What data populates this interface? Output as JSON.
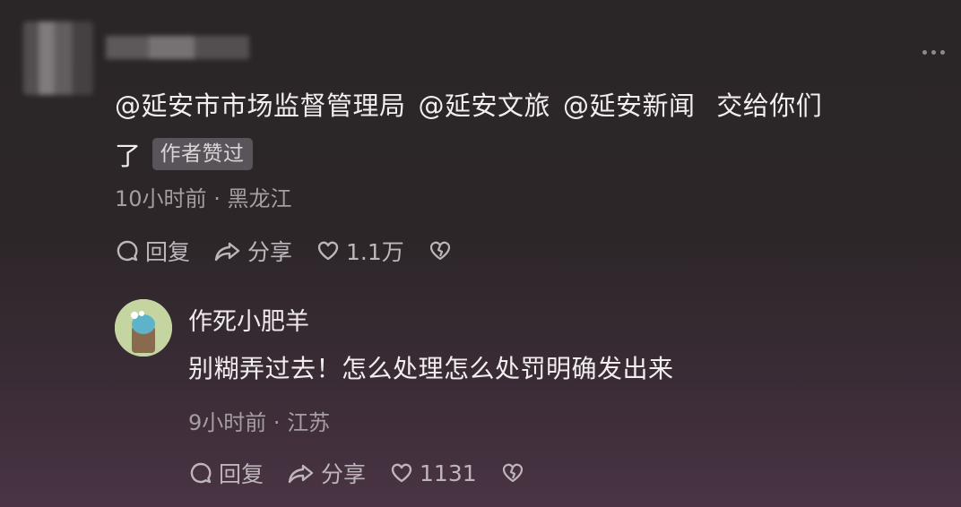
{
  "comment": {
    "mentions": [
      "@延安市市场监督管理局",
      "@延安文旅",
      "@延安新闻"
    ],
    "text_tail": "交给你们",
    "text_wrap": "了",
    "badge": "作者赞过",
    "time": "10小时前",
    "location": "黑龙江",
    "actions": {
      "reply": "回复",
      "share": "分享",
      "likes": "1.1万"
    }
  },
  "reply": {
    "username": "作死小肥羊",
    "text": "别糊弄过去！怎么处理怎么处罚明确发出来",
    "time": "9小时前",
    "location": "江苏",
    "actions": {
      "reply": "回复",
      "share": "分享",
      "likes": "1131"
    }
  },
  "icons": [
    "more-icon",
    "reply-icon",
    "share-icon",
    "like-icon",
    "dislike-icon"
  ]
}
